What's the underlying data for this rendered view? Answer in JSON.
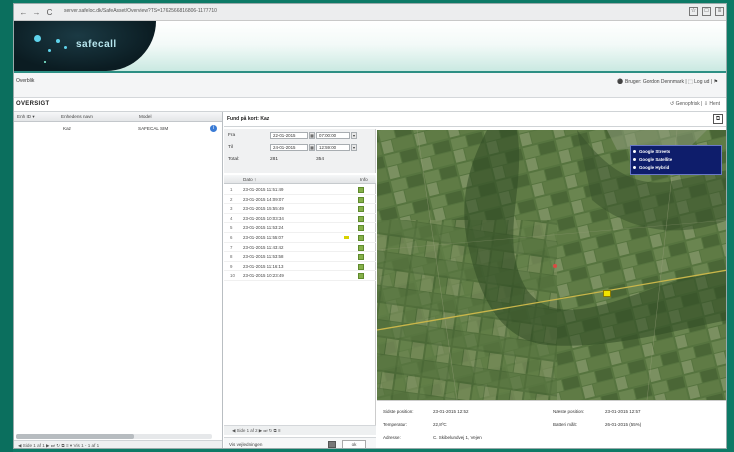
{
  "browser": {
    "url": "server.safeloc.dk/SafeAsset/Overview?TS=1762566816806-1177710",
    "nav_back": "←",
    "nav_forward": "→",
    "nav_reload": "C",
    "win_buttons": [
      "☆",
      "□",
      "≡"
    ]
  },
  "header": {
    "logo_text": "safecall",
    "menu_tab": "Overblik",
    "user_links": "⚫ Bruger: Gordon Dennmark  |  ⬚ Log ud  |  ⚑",
    "page_title": "OVERSIGT",
    "title_actions": "↺ Genopfrisk  |  ⇩ Hent"
  },
  "left_panel": {
    "columns": [
      "Enh ID ▾",
      "Enhedens navn",
      "Model"
    ],
    "row": {
      "id": "",
      "name": "Kaz",
      "model": "SAFECAL SIM",
      "icon": "info-icon"
    },
    "footer": "◀  Side  1  af 1  ▶  ⏭  ↻  ⧉  ≡  ▾            Vis 1 - 1 af 1"
  },
  "detail": {
    "title": "Fund på kort: Kaz",
    "form": {
      "fra_label": "Fra",
      "fra_date": "22-01-2015",
      "fra_time": "07:00:00",
      "til_label": "Til",
      "til_date": "24-01-2015",
      "til_time": "12:59:00",
      "total_label": "Total:",
      "total_value_1": "281",
      "total_value_2": "354"
    },
    "list_headers": [
      "Dato ↑",
      "Info"
    ],
    "rows": [
      {
        "n": "1",
        "d": "23-01-2015 11:51:49"
      },
      {
        "n": "2",
        "d": "23-01-2015 14:09:07"
      },
      {
        "n": "3",
        "d": "23-01-2015 15:55:49"
      },
      {
        "n": "4",
        "d": "23-01-2015 10:03:34"
      },
      {
        "n": "5",
        "d": "23-01-2015 11:53:24"
      },
      {
        "n": "6",
        "d": "23-01-2015 11:55:07"
      },
      {
        "n": "7",
        "d": "23-01-2015 11:43:42"
      },
      {
        "n": "8",
        "d": "23-01-2015 11:53:58"
      },
      {
        "n": "9",
        "d": "23-01-2015 11:16:13"
      },
      {
        "n": "10",
        "d": "23-01-2015 10:23:49"
      }
    ],
    "pager": "◀  Side  1  af 2  ▶  ⏭  ↻  ⧉  ≡",
    "bottom": "Vis vejledningen",
    "bottom_right": "ok"
  },
  "map": {
    "types": [
      "Google Streets",
      "Google Satellite",
      "Google Hybrid"
    ]
  },
  "info": {
    "left_keys": [
      "Sidste position:",
      "Temperatur:",
      "Adresse:"
    ],
    "left_vals": [
      "23-01-2015 12:52",
      "22,8ºC",
      "C. Skibelundvej 1, Vejen"
    ],
    "right_keys": [
      "Næste position:",
      "Batteri målt:"
    ],
    "right_vals": [
      "23-01-2015 12:57",
      "26-01-2015 (55%)"
    ]
  }
}
